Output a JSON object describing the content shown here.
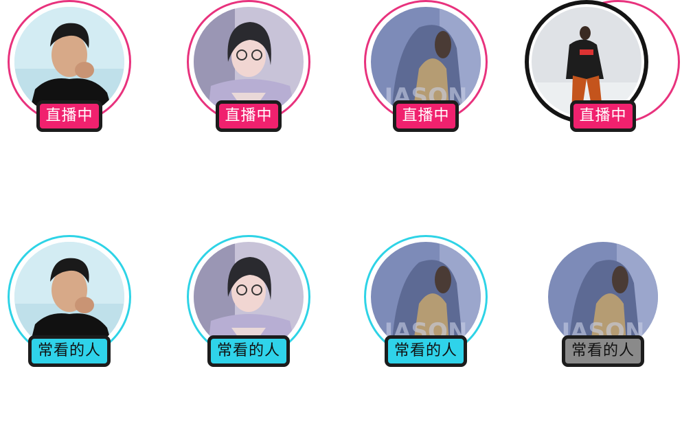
{
  "colors": {
    "live_ring": "#e8327d",
    "live_badge": "#f0216e",
    "frequent_ring": "#2ed3e6",
    "frequent_badge": "#2fd3ea",
    "inactive_badge": "#8a8a8a",
    "badge_border": "#1c1c1c"
  },
  "live_row": {
    "items": [
      {
        "badge": "直播中",
        "photo": "man-black-turtleneck"
      },
      {
        "badge": "直播中",
        "photo": "woman-glasses"
      },
      {
        "badge": "直播中",
        "photo": "hooded-figure-jason"
      },
      {
        "badge": "直播中",
        "photo": "person-orange-pants"
      }
    ]
  },
  "frequent_row": {
    "items": [
      {
        "badge": "常看的人",
        "photo": "man-black-turtleneck"
      },
      {
        "badge": "常看的人",
        "photo": "woman-glasses"
      },
      {
        "badge": "常看的人",
        "photo": "hooded-figure-jason"
      },
      {
        "badge": "常看的人",
        "photo": "hooded-figure-jason",
        "state": "inactive"
      }
    ]
  },
  "watermark_text": "JASON"
}
